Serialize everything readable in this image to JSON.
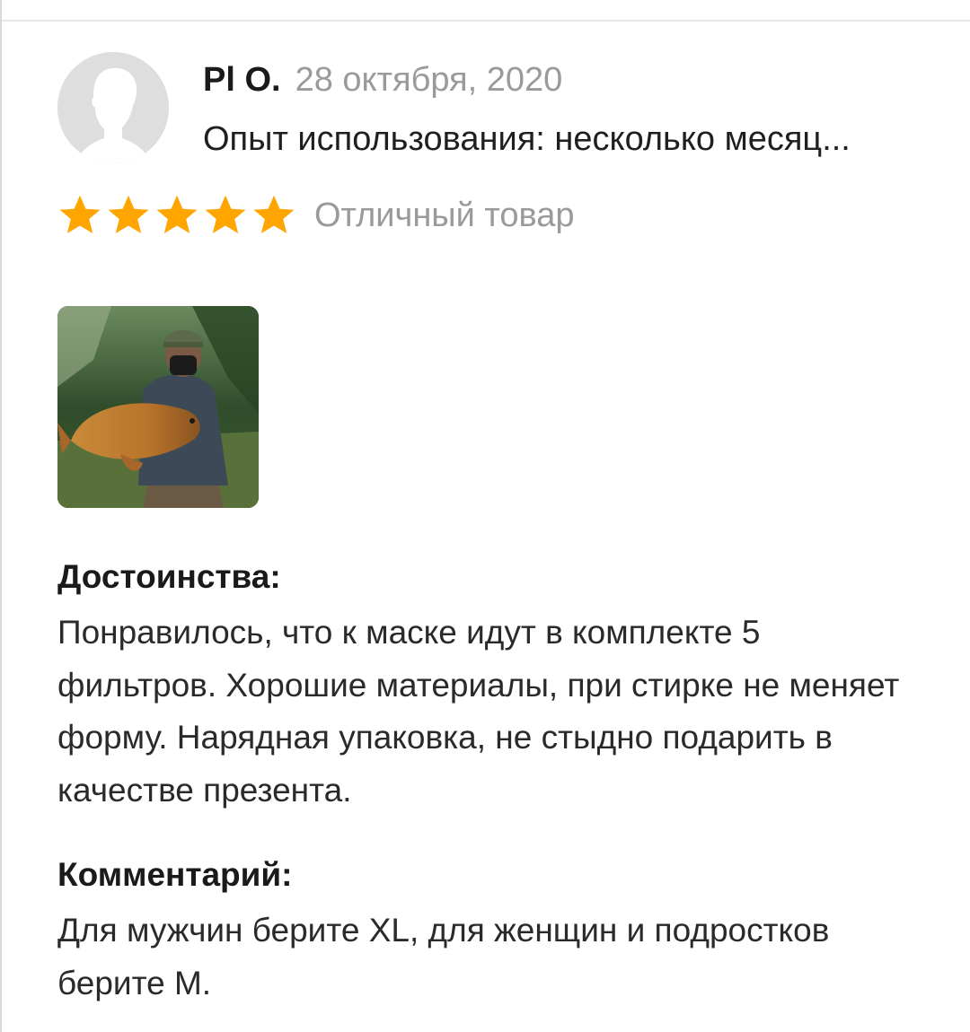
{
  "review": {
    "author": "Pl O.",
    "date": "28 октября, 2020",
    "usage": "Опыт использования: несколько месяц...",
    "rating": {
      "value": 5,
      "max": 5,
      "label": "Отличный товар",
      "star_color": "#ffa500"
    },
    "pros": {
      "title": "Достоинства:",
      "text": "Понравилось, что к маске идут в комплекте 5 фильтров. Хорошие материалы, при стирке не меняет форму. Нарядная упаковка, не стыдно подарить в качестве презента."
    },
    "comment": {
      "title": "Комментарий:",
      "text": "Для мужчин берите XL, для женщин и подростков берите М."
    }
  },
  "icons": {
    "avatar": "user-silhouette-icon",
    "star": "star-icon"
  }
}
